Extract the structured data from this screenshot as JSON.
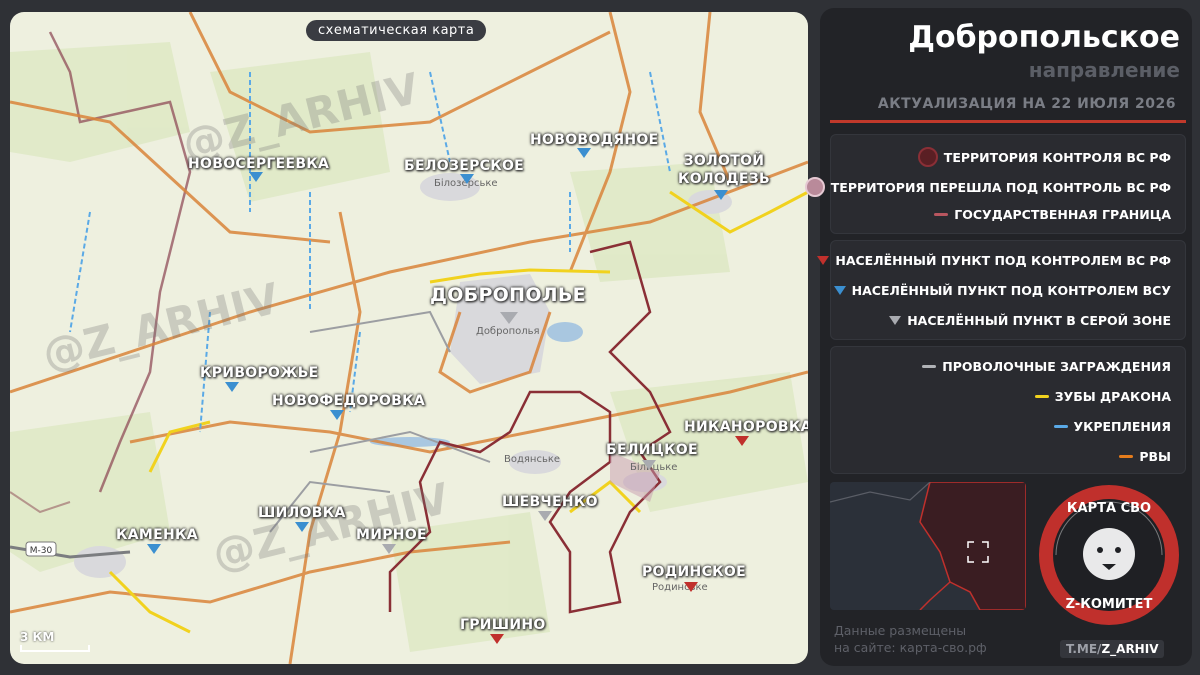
{
  "map": {
    "tag": "схематическая карта",
    "scale_label": "3 КМ",
    "watermark": "@Z_ARHIV",
    "main_city": {
      "label": "ДОБРОПОЛЬЕ",
      "sub": "Доброполья"
    },
    "cities": [
      {
        "key": "novosergeevka",
        "label": "НОВОСЕРГЕЕВКА",
        "control": "ua"
      },
      {
        "key": "belozerskoe",
        "label": "БЕЛОЗЕРСКОЕ",
        "sub": "Білозерське",
        "control": "ua"
      },
      {
        "key": "novovodyanoe",
        "label": "НОВОВОДЯНОЕ",
        "control": "ua"
      },
      {
        "key": "zolotoy",
        "label": "ЗОЛОТОЙ\nКОЛОДЕЗЬ",
        "control": "ua"
      },
      {
        "key": "krivorozhe",
        "label": "КРИВОРОЖЬЕ",
        "control": "ua"
      },
      {
        "key": "novofedorovka",
        "label": "НОВОФЕДОРОВКА",
        "control": "ua"
      },
      {
        "key": "nikanorovka",
        "label": "НИКАНОРОВКА",
        "control": "ru"
      },
      {
        "key": "belitskoe",
        "label": "БЕЛИЦКОЕ",
        "sub": "Білицьке",
        "control": "grey"
      },
      {
        "key": "vodyanske",
        "label": "",
        "sub": "Водянське",
        "control": "none"
      },
      {
        "key": "shevchenko",
        "label": "ШЕВЧЕНКО",
        "control": "grey"
      },
      {
        "key": "kamenka",
        "label": "КАМЕНКА",
        "control": "ua"
      },
      {
        "key": "shilovka",
        "label": "ШИЛОВКА",
        "control": "ua"
      },
      {
        "key": "mirnoe",
        "label": "МИРНОЕ",
        "control": "grey"
      },
      {
        "key": "rodinskoe",
        "label": "РОДИНСКОЕ",
        "sub": "Родинське",
        "control": "ru"
      },
      {
        "key": "grishino",
        "label": "ГРИШИНО",
        "control": "ru"
      }
    ],
    "road_label": "М-30"
  },
  "panel": {
    "title": "Добропольское",
    "subtitle": "направление",
    "date": "АКТУАЛИЗАЦИЯ НА 22 ИЮЛЯ 2026",
    "legend_territory": [
      {
        "label": "ТЕРРИТОРИЯ КОНТРОЛЯ ВС РФ",
        "color": "#5a1f24",
        "border": "#8a2f36",
        "kind": "circle"
      },
      {
        "label": "ТЕРРИТОРИЯ ПЕРЕШЛА ПОД КОНТРОЛЬ ВС РФ",
        "color": "#b98a9a",
        "border": "#e6c9d3",
        "kind": "circle"
      },
      {
        "label": "ГОСУДАРСТВЕННАЯ ГРАНИЦА",
        "color": "#b8565f",
        "kind": "line"
      }
    ],
    "legend_settlements": [
      {
        "label": "НАСЕЛЁННЫЙ ПУНКТ ПОД КОНТРОЛЕМ ВС РФ",
        "color": "#c0302c"
      },
      {
        "label": "НАСЕЛЁННЫЙ ПУНКТ ПОД КОНТРОЛЕМ ВСУ",
        "color": "#3b8fd0"
      },
      {
        "label": "НАСЕЛЁННЫЙ ПУНКТ В СЕРОЙ ЗОНЕ",
        "color": "#a9abb0"
      }
    ],
    "legend_fortifications": [
      {
        "label": "ПРОВОЛОЧНЫЕ ЗАГРАЖДЕНИЯ",
        "color": "#b0b2b6"
      },
      {
        "label": "ЗУБЫ ДРАКОНА",
        "color": "#f1d21e"
      },
      {
        "label": "УКРЕПЛЕНИЯ",
        "color": "#5aa9e6"
      },
      {
        "label": "РВЫ",
        "color": "#e57c1c"
      }
    ],
    "footer": {
      "line1": "Данные размещены",
      "line2": "на сайте: карта-сво.рф",
      "link_prefix": "T.ME/",
      "link_name": "Z_ARHIV"
    },
    "logo": {
      "top": "КАРТА СВО",
      "bottom": "Z-КОМИТЕТ"
    }
  }
}
